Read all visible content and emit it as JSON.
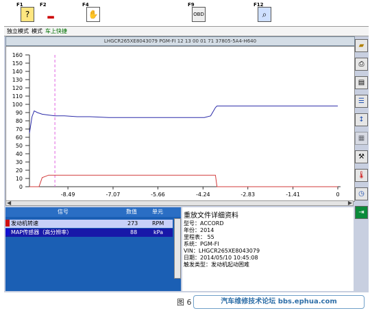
{
  "function_keys": [
    {
      "label": "F1",
      "icon": "help-icon"
    },
    {
      "label": "F2",
      "icon": "car-icon"
    },
    {
      "label": "F4",
      "icon": "tool-icon"
    },
    {
      "label": "F9",
      "icon": "obd-icon"
    },
    {
      "label": "F12",
      "icon": "print-preview-icon"
    }
  ],
  "mode_bar": {
    "mode1": "独立模式",
    "mode2": "模式",
    "mode3": "车上快捷"
  },
  "vehicle_id_line": "LHGCR265XE8043079  PGM-FI  12 13 00 01 71  37805-5A4-H640",
  "chart_data": {
    "type": "line",
    "y_ticks": [
      160,
      150,
      140,
      130,
      120,
      110,
      100,
      90,
      80,
      70,
      60,
      50,
      40,
      30,
      20,
      10,
      0
    ],
    "x_ticks": [
      "-8.49",
      "-7.07",
      "-5.66",
      "-4.24",
      "-2.83",
      "-1.41",
      "0"
    ],
    "ylim": [
      0,
      160
    ],
    "xlim": [
      -9.7,
      0
    ],
    "series": [
      {
        "color": "#2a2aa8",
        "x": [
          -9.7,
          -9.62,
          -9.55,
          -9.45,
          -9.3,
          -9.1,
          -8.9,
          -8.6,
          -8.2,
          -7.8,
          -7.2,
          -6.6,
          -6.0,
          -5.4,
          -4.9,
          -4.5,
          -4.2,
          -4.0,
          -3.85,
          -3.8,
          -3.0,
          -2.0,
          -1.0,
          0
        ],
        "values": [
          65,
          85,
          92,
          90,
          88,
          87,
          86,
          86,
          85,
          85,
          84,
          84,
          84,
          84,
          84,
          84,
          84,
          86,
          96,
          98,
          98,
          98,
          98,
          98
        ]
      },
      {
        "color": "#d23a3a",
        "x": [
          -9.7,
          -9.4,
          -9.3,
          -9.1,
          -8.5,
          -7.5,
          -6.5,
          -5.5,
          -4.5,
          -4.0,
          -3.85,
          -3.8,
          0
        ],
        "values": [
          0,
          0,
          11,
          14,
          14,
          14,
          14,
          14,
          14,
          14,
          14,
          0,
          0
        ]
      }
    ],
    "marker_x": -8.9
  },
  "table": {
    "headers": [
      "信号",
      "数值",
      "单元"
    ],
    "rows": [
      {
        "signal": "发动机转速",
        "value": "273",
        "unit": "RPM",
        "color": "#d01010"
      },
      {
        "signal": "MAP传感器（高分辨率）",
        "value": "88",
        "unit": "kPa",
        "color": "#1010d0"
      }
    ]
  },
  "detail": {
    "title": "重放文件详细资料",
    "lines": [
      "型号：ACCORD",
      "年份：2014",
      "里程表：  55",
      "系统：PGM-FI",
      "VIN：LHGCR265XE8043079",
      "日期：2014/05/10 10:45:08",
      "触发类型：发动机起动困难"
    ]
  },
  "caption": "图 6",
  "watermark": "汽车维修技术论坛 bbs.ephua.com"
}
